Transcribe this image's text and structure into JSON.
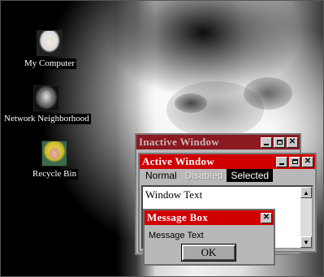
{
  "desktop": {
    "icons": [
      {
        "label": "My Computer",
        "icon": "my-computer-icon"
      },
      {
        "label": "Network Neighborhood",
        "icon": "network-neighborhood-icon"
      },
      {
        "label": "Recycle Bin",
        "icon": "recycle-bin-icon"
      }
    ]
  },
  "inactive_window": {
    "title": "Inactive Window",
    "title_color": "#8c1820"
  },
  "active_window": {
    "title": "Active Window",
    "title_color": "#d00000",
    "menu": [
      {
        "label": "Normal",
        "state": "normal"
      },
      {
        "label": "Disabled",
        "state": "disabled"
      },
      {
        "label": "Selected",
        "state": "selected"
      }
    ],
    "window_text": "Window Text"
  },
  "message_box": {
    "title": "Message Box",
    "text": "Message Text",
    "ok_label": "OK"
  },
  "colors": {
    "active_title": "#d00000",
    "inactive_title": "#8c1820",
    "window_face": "#b8b8b8"
  }
}
